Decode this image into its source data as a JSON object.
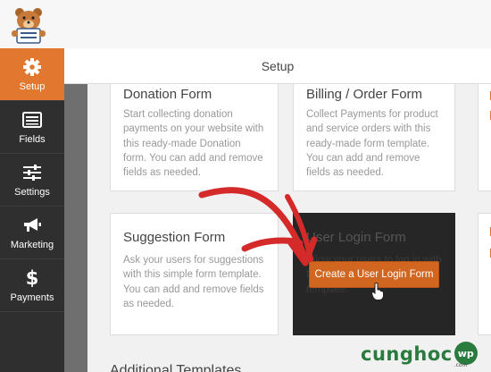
{
  "brand": {
    "logo_icon": "bear-mascot-icon"
  },
  "sidebar": {
    "items": [
      {
        "label": "Setup",
        "icon": "gear-icon",
        "active": true
      },
      {
        "label": "Fields",
        "icon": "fields-list-icon",
        "active": false
      },
      {
        "label": "Settings",
        "icon": "sliders-icon",
        "active": false
      },
      {
        "label": "Marketing",
        "icon": "megaphone-icon",
        "active": false
      },
      {
        "label": "Payments",
        "icon": "dollar-icon",
        "active": false
      }
    ]
  },
  "header": {
    "title": "Setup"
  },
  "templates": [
    {
      "title": "Donation Form",
      "description": "Start collecting donation payments on your website with this ready-made Donation form. You can add and remove fields as needed."
    },
    {
      "title": "Billing / Order Form",
      "description": "Collect Payments for product and service orders with this ready-made form template. You can add and remove fields as needed."
    },
    {
      "title": "Suggestion Form",
      "description": "Ask your users for suggestions with this simple form template. You can add and remove fields as needed."
    },
    {
      "title": "User Login Form",
      "description": "Allow your users to log in with this simple login form template.",
      "button_label": "Create a User Login Form"
    }
  ],
  "additional_templates_heading": "Additional Templates",
  "watermark": {
    "text": "cunghoc",
    "badge": "wp",
    "domain": ".com"
  },
  "colors": {
    "accent": "#e27730",
    "sidebar_bg": "#2f2f2f",
    "annotation_arrow": "#d42a2a",
    "watermark_green": "#2a7b3e"
  }
}
